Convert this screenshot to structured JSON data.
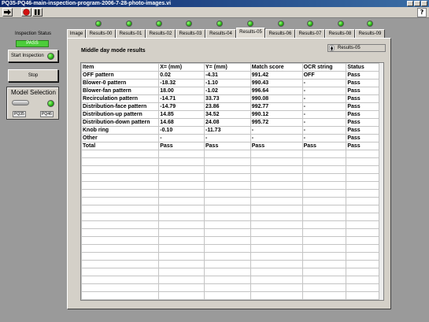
{
  "window": {
    "title": "PQ35-PQ46-main-inspection-program-2006-7-28-photo-images.vi"
  },
  "toolbar": {
    "help_label": "?"
  },
  "left_panel": {
    "status_label": "Inspection Status",
    "status_value": "PASS",
    "start_label": "Start Inspection",
    "stop_label": "Stop",
    "model_title": "Model Selection",
    "model_options": [
      "PQ35",
      "PQ46"
    ]
  },
  "tabs": [
    {
      "label": "Image"
    },
    {
      "label": "Results-00"
    },
    {
      "label": "Results-01"
    },
    {
      "label": "Results-02"
    },
    {
      "label": "Results-03"
    },
    {
      "label": "Results-04"
    },
    {
      "label": "Results-05"
    },
    {
      "label": "Results-06"
    },
    {
      "label": "Results-07"
    },
    {
      "label": "Results-08"
    },
    {
      "label": "Results-09"
    }
  ],
  "active_tab": "Results-05",
  "page": {
    "title": "Middle day mode results",
    "ring_value": "Results-05"
  },
  "table": {
    "headers": [
      "Item",
      "X=  (mm)",
      "Y=  (mm)",
      "Match score",
      "OCR string",
      "Status"
    ],
    "rows": [
      [
        "OFF pattern",
        "0.02",
        "-4.31",
        "991.42",
        "OFF",
        "Pass"
      ],
      [
        "Blower-0 pattern",
        "-18.32",
        "-1.10",
        "990.43",
        "-",
        "Pass"
      ],
      [
        "Blower-fan pattern",
        "18.00",
        "-1.02",
        "996.64",
        "-",
        "Pass"
      ],
      [
        "Recirculation pattern",
        "-14.71",
        "33.73",
        "990.08",
        "-",
        "Pass"
      ],
      [
        "Distribution-face pattern",
        "-14.79",
        "23.86",
        "992.77",
        "-",
        "Pass"
      ],
      [
        "Distribution-up pattern",
        "14.85",
        "34.52",
        "990.12",
        "-",
        "Pass"
      ],
      [
        "Distribution-down pattern",
        "14.68",
        "24.08",
        "995.72",
        "-",
        "Pass"
      ],
      [
        "Knob ring",
        "-0.10",
        "-11.73",
        "-",
        "-",
        "Pass"
      ],
      [
        "Other",
        "-",
        "-",
        "-",
        "-",
        "Pass"
      ],
      [
        "Total",
        "Pass",
        "Pass",
        "Pass",
        "Pass",
        "Pass"
      ]
    ]
  },
  "colors": {
    "panel": "#9a9a9a",
    "pass_green": "#4ccd3a",
    "led_green": "#24b012",
    "title_bar": "#0a246a"
  }
}
